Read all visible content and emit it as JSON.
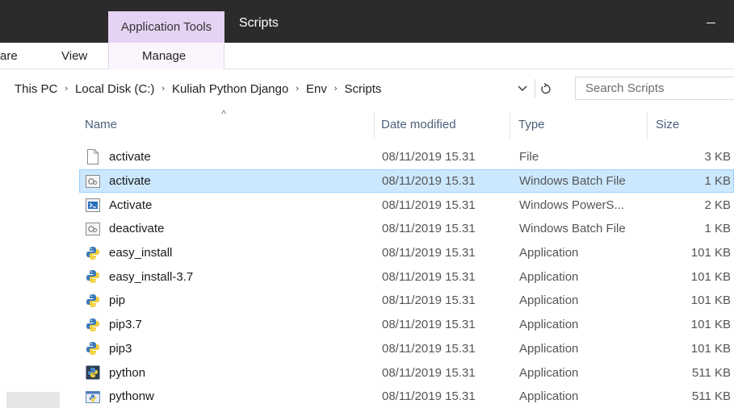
{
  "window": {
    "context_tab": "Application Tools",
    "title": "Scripts",
    "minimize_label": "—"
  },
  "ribbon": {
    "tabs": [
      "are",
      "View",
      "Manage"
    ]
  },
  "address": {
    "breadcrumbs": [
      "This PC",
      "Local Disk (C:)",
      "Kuliah Python Django",
      "Env",
      "Scripts"
    ],
    "separator": "›",
    "dropdown": "∨",
    "refresh": "↻",
    "search_placeholder": "Search Scripts"
  },
  "columns": {
    "name": "Name",
    "date": "Date modified",
    "type": "Type",
    "size": "Size",
    "sort_indicator": "^"
  },
  "files": [
    {
      "name": "activate",
      "date": "08/11/2019 15.31",
      "type": "File",
      "size": "3 KB",
      "icon": "file-icon",
      "selected": false
    },
    {
      "name": "activate",
      "date": "08/11/2019 15.31",
      "type": "Windows Batch File",
      "size": "1 KB",
      "icon": "batch-file-icon",
      "selected": true
    },
    {
      "name": "Activate",
      "date": "08/11/2019 15.31",
      "type": "Windows PowerS...",
      "size": "2 KB",
      "icon": "powershell-file-icon",
      "selected": false
    },
    {
      "name": "deactivate",
      "date": "08/11/2019 15.31",
      "type": "Windows Batch File",
      "size": "1 KB",
      "icon": "batch-file-icon",
      "selected": false
    },
    {
      "name": "easy_install",
      "date": "08/11/2019 15.31",
      "type": "Application",
      "size": "101 KB",
      "icon": "python-app-icon",
      "selected": false
    },
    {
      "name": "easy_install-3.7",
      "date": "08/11/2019 15.31",
      "type": "Application",
      "size": "101 KB",
      "icon": "python-app-icon",
      "selected": false
    },
    {
      "name": "pip",
      "date": "08/11/2019 15.31",
      "type": "Application",
      "size": "101 KB",
      "icon": "python-app-icon",
      "selected": false
    },
    {
      "name": "pip3.7",
      "date": "08/11/2019 15.31",
      "type": "Application",
      "size": "101 KB",
      "icon": "python-app-icon",
      "selected": false
    },
    {
      "name": "pip3",
      "date": "08/11/2019 15.31",
      "type": "Application",
      "size": "101 KB",
      "icon": "python-app-icon",
      "selected": false
    },
    {
      "name": "python",
      "date": "08/11/2019 15.31",
      "type": "Application",
      "size": "511 KB",
      "icon": "python-exe-icon",
      "selected": false
    },
    {
      "name": "pythonw",
      "date": "08/11/2019 15.31",
      "type": "Application",
      "size": "511 KB",
      "icon": "pythonw-exe-icon",
      "selected": false
    }
  ],
  "colors": {
    "titlebar": "#2b2b2b",
    "context_tab": "#e6d2f2",
    "selection": "#cce8ff",
    "selection_border": "#99d1ff",
    "column_header_text": "#4c607a"
  }
}
